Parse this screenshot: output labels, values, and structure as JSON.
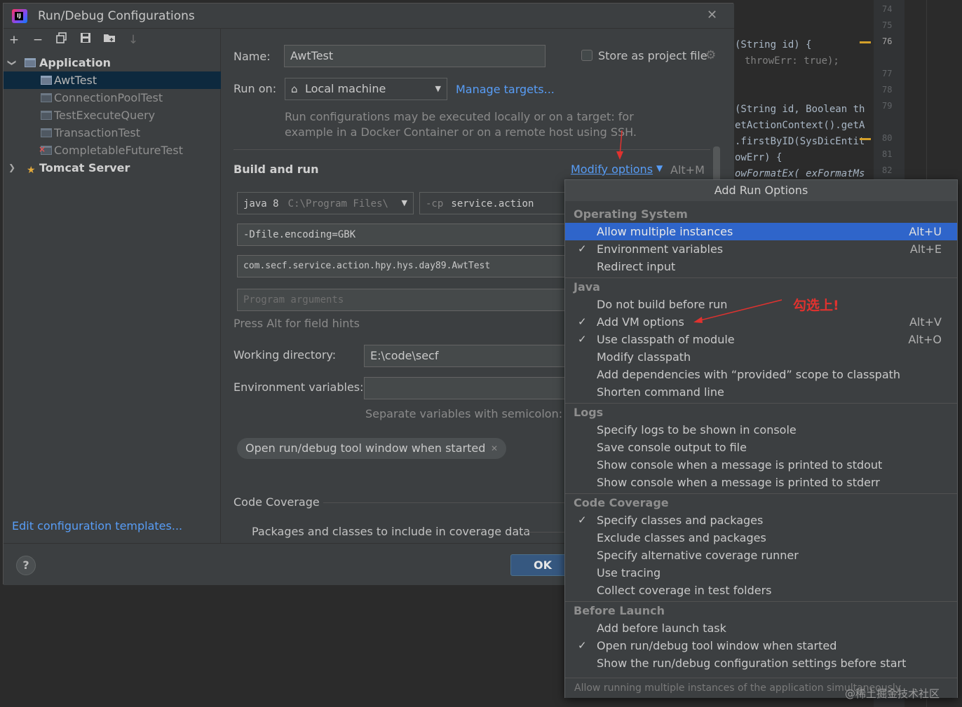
{
  "dialog": {
    "title": "Run/Debug Configurations",
    "close": "✕"
  },
  "toolbar": {
    "add": "+",
    "remove": "−",
    "copy": "⧉",
    "save": "💾",
    "folder": "📁",
    "sort": "↓"
  },
  "tree": {
    "application": "Application",
    "items": [
      "AwtTest",
      "ConnectionPoolTest",
      "TestExecuteQuery",
      "TransactionTest",
      "CompletableFutureTest"
    ],
    "tomcat": "Tomcat Server"
  },
  "edit_templates": "Edit configuration templates...",
  "form": {
    "name_label": "Name:",
    "name_value": "AwtTest",
    "store_label": "Store as project file",
    "runon_label": "Run on:",
    "runon_value": "Local machine",
    "manage_targets": "Manage targets...",
    "runon_hint_1": "Run configurations may be executed locally or on a target: for",
    "runon_hint_2": "example in a Docker Container or on a remote host using SSH.",
    "build_run": "Build and run",
    "modify_options": "Modify options",
    "modify_shortcut": "Alt+M",
    "jre_value": "java 8",
    "jre_path": "C:\\Program Files\\",
    "cp_prefix": "-cp",
    "cp_value": "service.action",
    "vm_options": "-Dfile.encoding=GBK",
    "main_class": "com.secf.service.action.hpy.hys.day89.AwtTest",
    "program_args_placeholder": "Program arguments",
    "press_alt_hint": "Press Alt for field hints",
    "workdir_label": "Working directory:",
    "workdir_value": "E:\\code\\secf",
    "env_label": "Environment variables:",
    "env_hint": "Separate variables with semicolon: VA",
    "chip_open_tool": "Open run/debug tool window when started",
    "code_coverage": "Code Coverage",
    "packages_label": "Packages and classes to include in coverage data"
  },
  "footer": {
    "help": "?",
    "ok": "OK"
  },
  "popup": {
    "title": "Add Run Options",
    "groups": {
      "os": "Operating System",
      "java": "Java",
      "logs": "Logs",
      "coverage": "Code Coverage",
      "before": "Before Launch"
    },
    "items": {
      "allow_multiple": "Allow multiple instances",
      "allow_multiple_sc": "Alt+U",
      "env_vars": "Environment variables",
      "env_vars_sc": "Alt+E",
      "redirect_input": "Redirect input",
      "no_build": "Do not build before run",
      "add_vm": "Add VM options",
      "add_vm_sc": "Alt+V",
      "use_classpath": "Use classpath of module",
      "use_classpath_sc": "Alt+O",
      "modify_classpath": "Modify classpath",
      "add_provided": "Add dependencies with “provided” scope to classpath",
      "shorten_cmd": "Shorten command line",
      "logs_console": "Specify logs to be shown in console",
      "save_console": "Save console output to file",
      "show_stdout": "Show console when a message is printed to stdout",
      "show_stderr": "Show console when a message is printed to stderr",
      "specify_classes": "Specify classes and packages",
      "exclude_classes": "Exclude classes and packages",
      "alt_runner": "Specify alternative coverage runner",
      "use_tracing": "Use tracing",
      "collect_tests": "Collect coverage in test folders",
      "add_before": "Add before launch task",
      "open_tool": "Open run/debug tool window when started",
      "show_settings": "Show the run/debug configuration settings before start"
    },
    "check": "✓",
    "footer": "Allow running multiple instances of the application simultaneously"
  },
  "annotation": "勾选上!",
  "watermark": "@稀土掘金技术社区",
  "editor": {
    "lines": [
      "(String id) {",
      "throwErr: true);",
      "(String id, Boolean th",
      "etActionContext().getA",
      ".firstByID(SysDicEntit",
      "owErr) {",
      "owFormatEx( exFormatMs"
    ],
    "line_numbers": [
      "74",
      "75",
      "76",
      "77",
      "78",
      "79",
      "80",
      "81",
      "82"
    ]
  }
}
